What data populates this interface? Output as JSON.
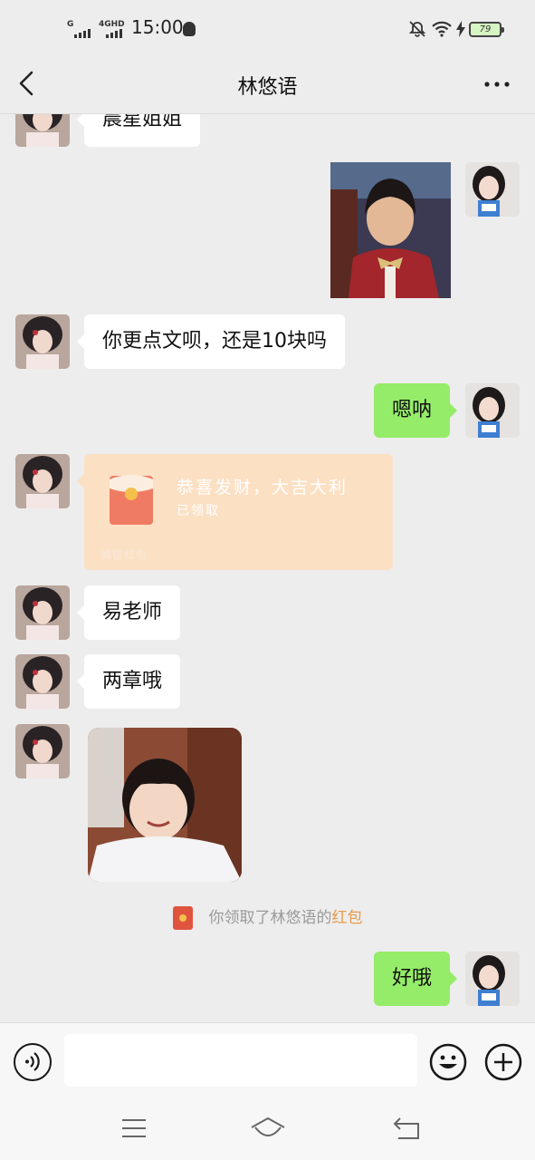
{
  "status_bar": {
    "signal1_label": "G",
    "signal2_label": "4GHD",
    "time": "15:00",
    "battery": "79"
  },
  "header": {
    "title": "林悠语"
  },
  "messages": [
    {
      "side": "left",
      "type": "text",
      "text": "晨星姐姐"
    },
    {
      "side": "right",
      "type": "image",
      "alt": "boy-photo"
    },
    {
      "side": "left",
      "type": "text",
      "text": "你更点文呗，还是10块吗"
    },
    {
      "side": "right",
      "type": "text",
      "text": "嗯呐"
    },
    {
      "side": "left",
      "type": "red_packet",
      "title": "恭喜发财，大吉大利",
      "status": "已领取",
      "label": "微信红包"
    },
    {
      "side": "left",
      "type": "text",
      "text": "易老师"
    },
    {
      "side": "left",
      "type": "text",
      "text": "两章哦"
    },
    {
      "side": "left",
      "type": "image",
      "alt": "girl-photo"
    },
    {
      "side": "center",
      "type": "notice",
      "text": "你领取了林悠语的",
      "link": "红包"
    },
    {
      "side": "right",
      "type": "text",
      "text": "好哦"
    }
  ],
  "input": {
    "value": "",
    "placeholder": ""
  },
  "colors": {
    "bg": "#ededed",
    "bubble_green": "#95ec69",
    "bubble_white": "#ffffff",
    "red_packet": "#fce0c3",
    "link_orange": "#e89a4a"
  }
}
